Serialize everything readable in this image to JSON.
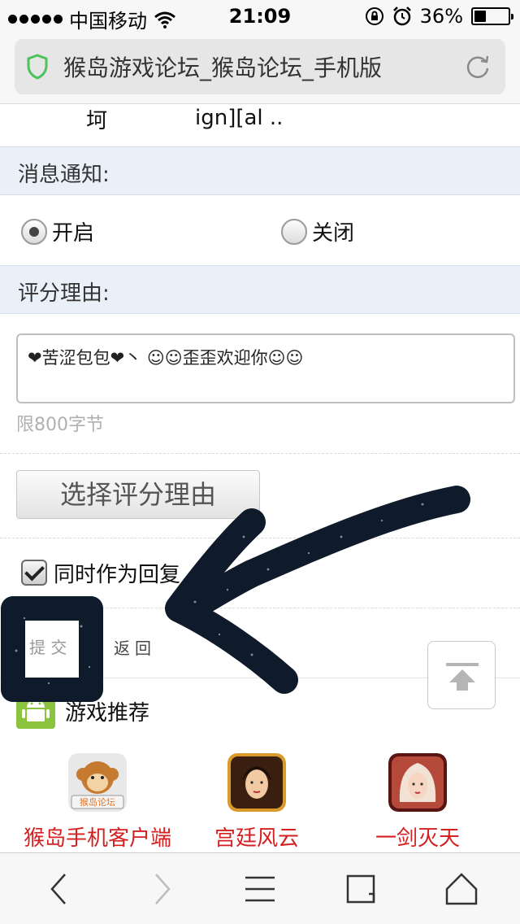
{
  "status_bar": {
    "carrier": "中国移动",
    "time": "21:09",
    "battery": "36%",
    "battery_level": 0.36
  },
  "browser": {
    "page_title": "猴岛游戏论坛_猴岛论坛_手机版"
  },
  "top_row": {
    "left_text": "坷",
    "right_text": "ign][al .."
  },
  "notify": {
    "label": "消息通知:",
    "option_on": "开启",
    "option_off": "关闭",
    "selected": "开启"
  },
  "reason": {
    "label": "评分理由:",
    "value": "❤苦涩包包❤丶 ☺☺歪歪欢迎你☺☺",
    "limit_hint": "限800字节",
    "select_button": "选择评分理由"
  },
  "reply_checkbox": {
    "label": "同时作为回复",
    "checked": true
  },
  "actions": {
    "submit": "提 交",
    "back": "返回"
  },
  "games": {
    "header": "游戏推荐",
    "items": [
      {
        "name": "猴岛手机客户端",
        "icon_text": "猴岛论坛",
        "icon": "monkey-logo-icon"
      },
      {
        "name": "宫廷风云",
        "icon": "palace-portrait-icon"
      },
      {
        "name": "一剑灭天",
        "icon": "swordsman-portrait-icon"
      }
    ]
  },
  "colors": {
    "game_name": "#d42020",
    "section_bg": "#eaf0f8",
    "scribble": "#0f1a2a"
  }
}
